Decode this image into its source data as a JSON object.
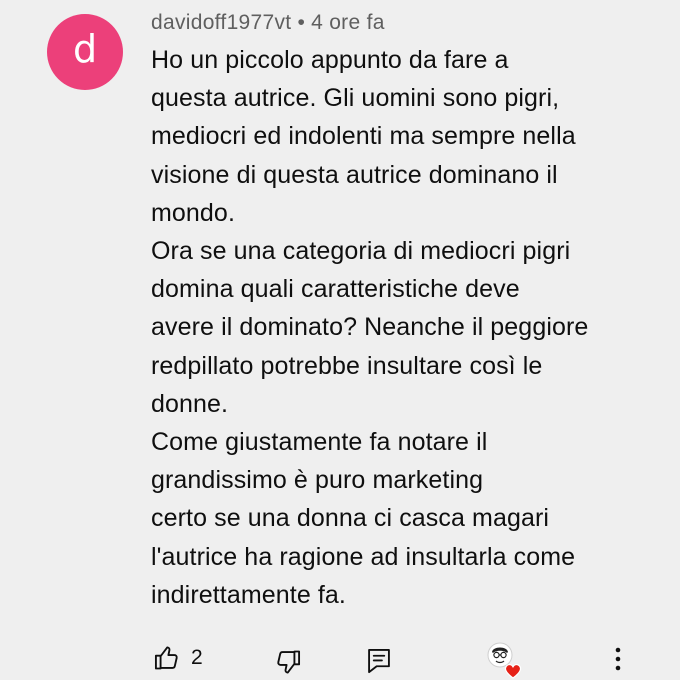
{
  "comment": {
    "avatar_letter": "d",
    "avatar_color": "#ec407a",
    "author": "davidoff1977vt",
    "separator": "•",
    "timestamp": "4 ore fa",
    "lines": [
      "Ho un piccolo appunto da fare a",
      "questa autrice. Gli uomini sono pigri,",
      "mediocri ed indolenti ma sempre nella",
      "visione di questa autrice dominano il",
      "mondo.",
      "Ora se una categoria di mediocri pigri",
      "domina quali caratteristiche deve",
      "avere il dominato? Neanche il peggiore",
      "redpillato potrebbe insultare così le",
      "donne.",
      "Come giustamente fa notare il",
      "grandissimo è puro marketing",
      "certo se una donna ci casca magari",
      "l'autrice ha ragione ad insultarla come",
      "indirettamente fa."
    ]
  },
  "actions": {
    "like_icon": "thumbs-up-icon",
    "like_count": "2",
    "dislike_icon": "thumbs-down-icon",
    "reply_icon": "reply-icon",
    "creator_heart_icon": "creator-heart-icon",
    "heart_color": "#e62117",
    "more_icon": "more-vert-icon"
  }
}
